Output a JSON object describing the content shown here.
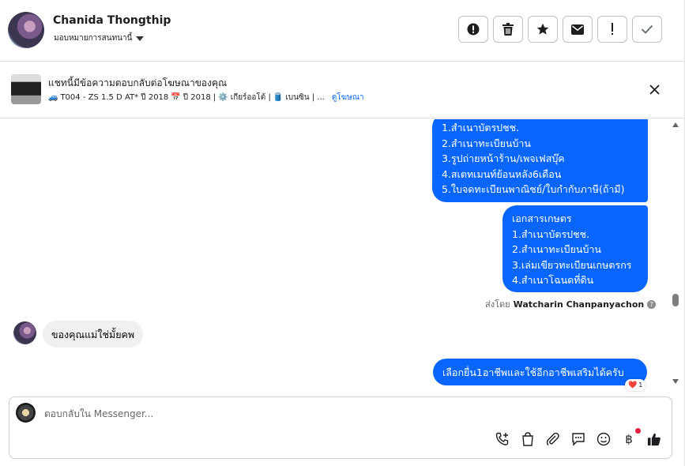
{
  "header": {
    "contact_name": "Chanida Thongthip",
    "assign_label": "มอบหมายการสนทนานี้",
    "actions": [
      {
        "icon": "report-icon",
        "label": "Report"
      },
      {
        "icon": "trash-icon",
        "label": "Delete"
      },
      {
        "icon": "star-icon",
        "label": "Follow up"
      },
      {
        "icon": "envelope-icon",
        "label": "Mark as unread"
      },
      {
        "icon": "spam-icon",
        "label": "Spam"
      },
      {
        "icon": "check-icon",
        "label": "Done"
      }
    ]
  },
  "ad_banner": {
    "title": "แชทนี้มีข้อความตอบกลับต่อโฆษณาของคุณ",
    "car_emoji": "🚙",
    "car_text": "T004 - ZS 1.5 D AT* ปี 2018",
    "calendar_emoji": "📅",
    "year_text": "ปี 2018 |",
    "gear_emoji": "⚙️",
    "gear_text": "เกียร์ออโต้ |",
    "fuel_emoji": "🛢️",
    "fuel_text": "เบนซิน | ...",
    "link": "ดูโฆษณา"
  },
  "thread": {
    "outgoing_1": [
      "1.สำเนาบัตรปชช.",
      "2.สำเนาทะเบียนบ้าน",
      "3.รูปถ่ายหน้าร้าน/เพจเฟสบุ๊ค",
      "4.สเตทเมนท์ย้อนหลัง6เดือน",
      "5.ใบจดทะเบียนพาณิชย์/ใบกำกับภาษี(ถ้ามี)"
    ],
    "outgoing_2": [
      "เอกสารเกษตร",
      "1.สำเนาบัตรปชช.",
      "2.สำเนาทะเบียนบ้าน",
      "3.เล่มเขียวทะเบียนเกษตรกร",
      "4.สำเนาโฉนดที่ดิน"
    ],
    "sent_by_prefix": "ส่งโดย",
    "sent_by_name": "Watcharin Chanpanyachon",
    "help_glyph": "?",
    "incoming": "ของคุณแม่ใช่มั้ยคพ",
    "outgoing_3": "เลือกยื่น1อาชีพและใช้อีกอาชีพเสริมได้ครับ",
    "reaction": {
      "emoji": "❤️",
      "count": "1"
    }
  },
  "composer": {
    "placeholder": "ตอบกลับใน Messenger...",
    "tools": [
      "call-add-icon",
      "shopping-bag-icon",
      "paperclip-icon",
      "saved-reply-icon",
      "emoji-icon",
      "baht-icon",
      "thumbs-up-icon"
    ],
    "baht_glyph": "฿"
  },
  "colors": {
    "accent": "#0866ff",
    "incoming_bg": "#f0f0f0",
    "muted": "#65676b"
  }
}
